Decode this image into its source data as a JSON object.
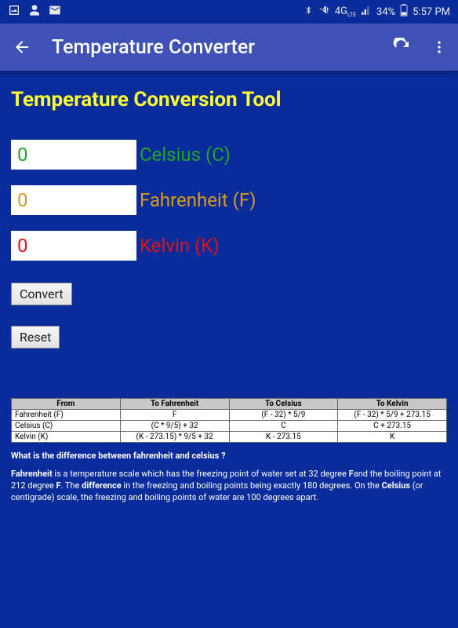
{
  "statusbar": {
    "battery": "34%",
    "time": "5:57 PM",
    "network": "4G"
  },
  "appbar": {
    "title": "Temperature Converter"
  },
  "page": {
    "title": "Temperature Conversion Tool"
  },
  "fields": {
    "celsius": {
      "value": "0",
      "label": "Celsius (C)"
    },
    "fahrenheit": {
      "value": "0",
      "label": "Fahrenheit (F)"
    },
    "kelvin": {
      "value": "0",
      "label": "Kelvin (K)"
    }
  },
  "buttons": {
    "convert": "Convert",
    "reset": "Reset"
  },
  "table": {
    "headers": [
      "From",
      "To Fahrenheit",
      "To Celsius",
      "To Kelvin"
    ],
    "rows": [
      [
        "Fahrenheit (F)",
        "F",
        "(F - 32) * 5/9",
        "(F - 32) * 5/9 + 273.15"
      ],
      [
        "Celsius (C)",
        "(C * 9/5) + 32",
        "C",
        "C + 273.15"
      ],
      [
        "Kelvin (K)",
        "(K - 273.15) * 9/5 + 32",
        "K - 273.15",
        "K"
      ]
    ]
  },
  "explain": {
    "question": "What is the difference between fahrenheit and celsius ?",
    "p1a": "Fahrenheit",
    "p1b": " is a temperature scale which has the freezing point of water set at 32 degree ",
    "p1c": "F",
    "p1d": "and the boiling point at 212 degree ",
    "p1e": "F",
    "p1f": ". The ",
    "p1g": "difference",
    "p1h": " in the freezing and boiling points being exactly 180 degrees. On the ",
    "p1i": "Celsius",
    "p1j": " (or centigrade) scale, the freezing and boiling points of water are 100 degrees apart."
  }
}
